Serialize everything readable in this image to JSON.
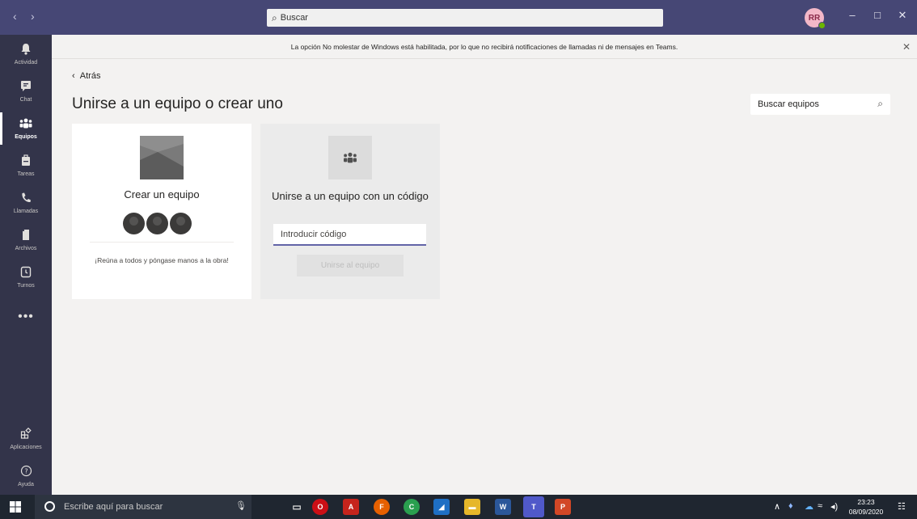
{
  "titlebar": {
    "search_placeholder": "Buscar",
    "avatar_initials": "RR"
  },
  "rail": {
    "items": [
      {
        "label": "Actividad"
      },
      {
        "label": "Chat"
      },
      {
        "label": "Equipos"
      },
      {
        "label": "Tareas"
      },
      {
        "label": "Llamadas"
      },
      {
        "label": "Archivos"
      },
      {
        "label": "Turnos"
      },
      {
        "label": "Aplicaciones"
      },
      {
        "label": "Ayuda"
      }
    ],
    "active": "Equipos",
    "more": "•••"
  },
  "banner": {
    "text": "La opción No molestar de Windows está habilitada, por lo que no recibirá notificaciones de llamadas ni de mensajes en Teams."
  },
  "main": {
    "back_label": "Atrás",
    "title": "Unirse a un equipo o crear uno",
    "team_search_placeholder": "Buscar equipos",
    "create_card": {
      "title": "Crear un equipo",
      "description": "¡Reúna a todos y póngase manos a la obra!"
    },
    "join_card": {
      "title": "Unirse a un equipo con un código",
      "code_placeholder": "Introducir código",
      "button_label": "Unirse al equipo"
    }
  },
  "taskbar": {
    "search_placeholder": "Escribe aquí para buscar",
    "time": "23:23",
    "date": "08/09/2020"
  },
  "colors": {
    "titlebar": "#464775",
    "rail": "#33344a",
    "accent": "#6264a7",
    "taskbar": "#1f2630"
  }
}
